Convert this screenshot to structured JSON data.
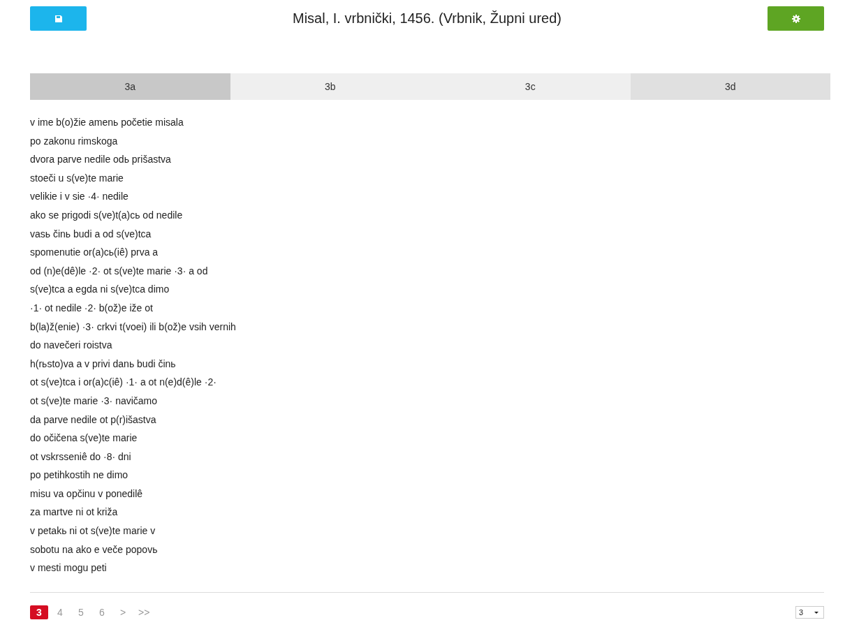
{
  "header": {
    "title": "Misal, I. vrbnički, 1456. (Vrbnik, Župni ured)"
  },
  "tabs": [
    {
      "label": "3a",
      "selected": true,
      "hovered": false
    },
    {
      "label": "3b",
      "selected": false,
      "hovered": false
    },
    {
      "label": "3c",
      "selected": false,
      "hovered": false
    },
    {
      "label": "3d",
      "selected": false,
      "hovered": true
    }
  ],
  "lines": [
    "v ime b(o)žie amenь početie misala",
    "po zakonu rimskoga",
    "dvora parve nedile odь prišastva",
    "stoeči u s(ve)te marie",
    "velikie i v sie ·4· nedile",
    "ako se prigodi s(ve)t(a)cь od nedile",
    "vasь činь budi a od s(ve)tca",
    "spomenutie or(a)cь(iê) prva a",
    "od (n)e(dê)le ·2· ot s(ve)te marie ·3· a od",
    "s(ve)tca a egda ni s(ve)tca dimo",
    "·1· ot nedile ·2· b(ož)e iže ot",
    "b(la)ž(enie) ·3· crkvi t(voei) ili b(ož)e vsih vernih",
    "do navečeri roistva",
    "h(rьsto)va a v privi danь budi činь",
    "ot s(ve)tca i or(a)c(iê) ·1· a ot n(e)d(ê)le ·2·",
    "ot s(ve)te marie ·3· navičamo",
    "da parve nedile ot p(r)išastva",
    "do očičena s(ve)te marie",
    "ot vskrsseniê do ·8· dni",
    "po petihkostih ne dimo",
    "misu va opčinu v ponedilê",
    "za martve ni ot križa",
    "v petakь ni ot s(ve)te marie v",
    "sobotu na ako e veče popovь",
    "v mesti mogu peti"
  ],
  "pagination": {
    "pages": [
      {
        "label": "3",
        "selected": true
      },
      {
        "label": "4",
        "selected": false
      },
      {
        "label": "5",
        "selected": false
      },
      {
        "label": "6",
        "selected": false
      },
      {
        "label": ">",
        "selected": false
      },
      {
        "label": ">>",
        "selected": false
      }
    ],
    "page_select": {
      "value": "3"
    }
  }
}
